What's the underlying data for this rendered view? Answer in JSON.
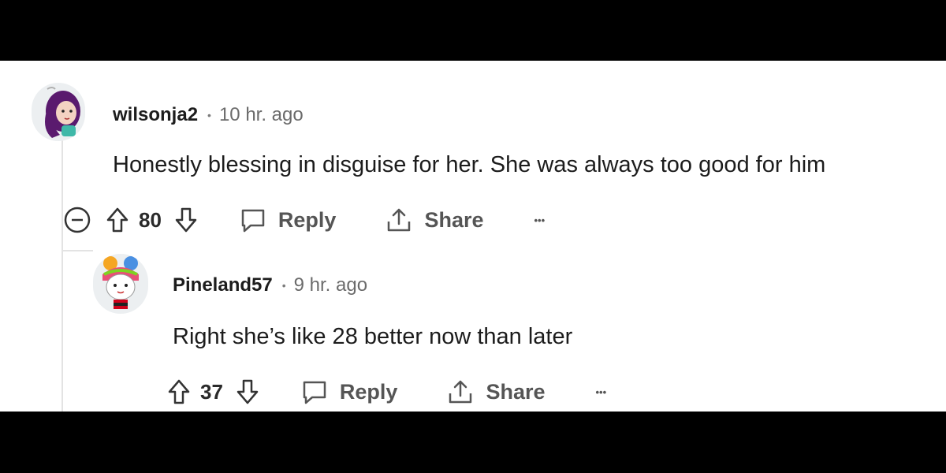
{
  "comments": [
    {
      "username": "wilsonja2",
      "separator": "•",
      "time": "10 hr. ago",
      "body": "Honestly blessing in disguise for her. She was always too good for him",
      "votes": "80",
      "reply_label": "Reply",
      "share_label": "Share",
      "more_label": "•••",
      "avatar_icon": "purple-hair-avatar-icon"
    },
    {
      "username": "Pineland57",
      "separator": "•",
      "time": "9 hr. ago",
      "body": "Right she’s like 28 better now than later",
      "votes": "37",
      "reply_label": "Reply",
      "share_label": "Share",
      "more_label": "•••",
      "avatar_icon": "rainbow-hair-avatar-icon"
    }
  ],
  "colors": {
    "letterbox": "#000000",
    "background": "#ffffff",
    "text": "#1c1c1c",
    "muted": "#6b6b6b",
    "thread_line": "#e3e3e3"
  }
}
